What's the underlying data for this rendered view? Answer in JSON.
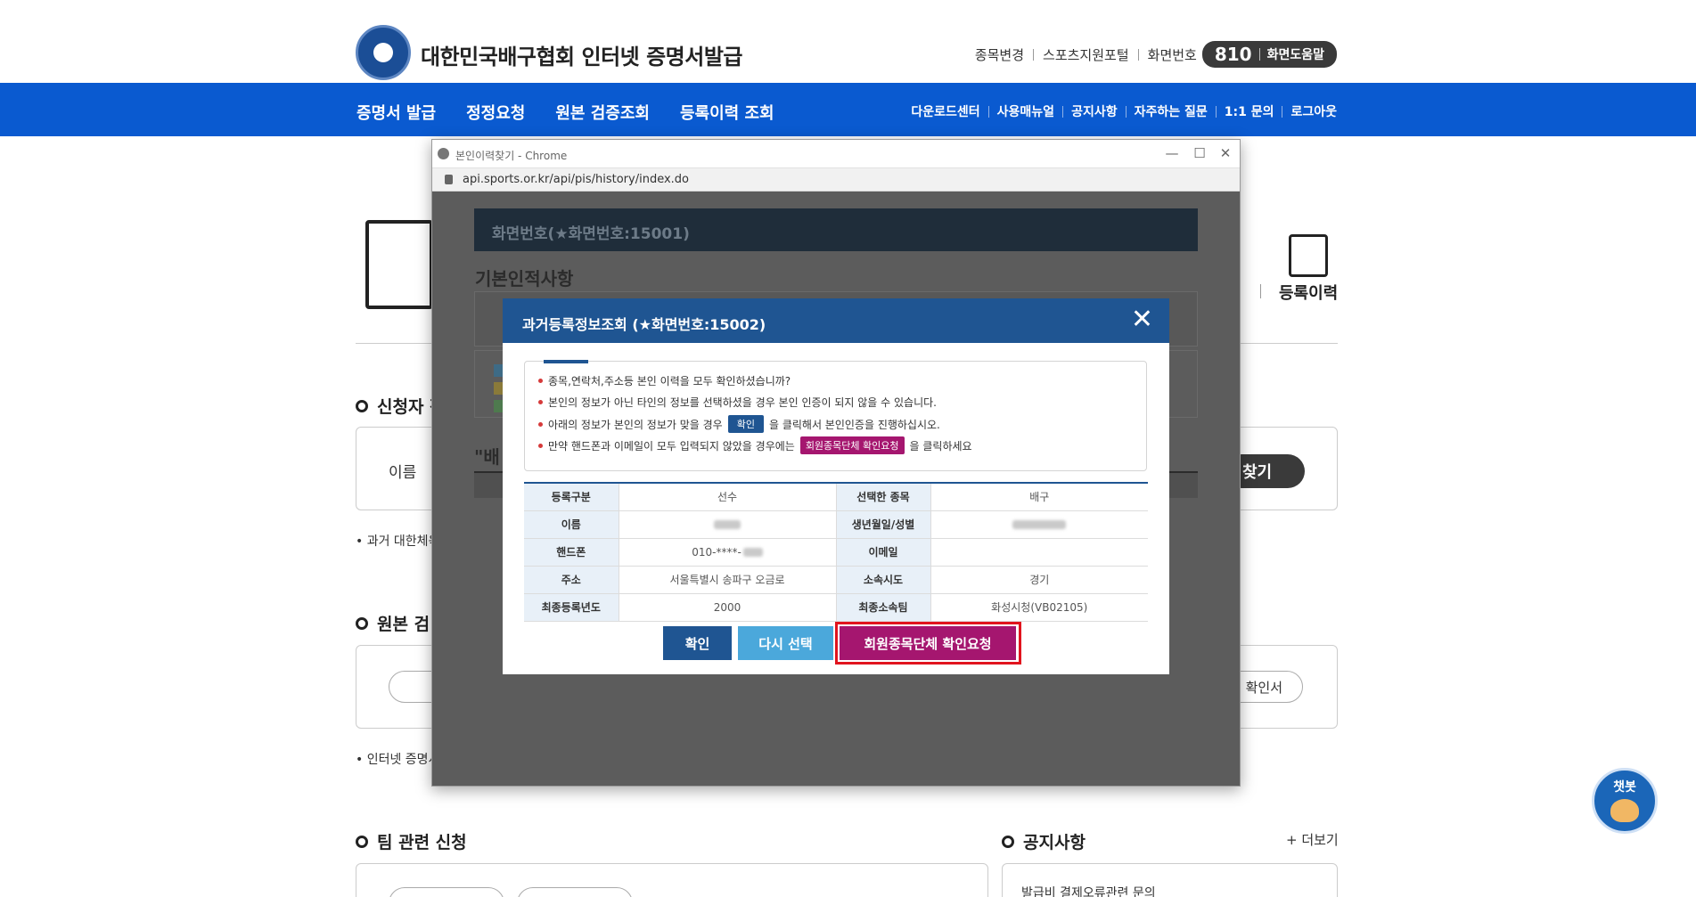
{
  "site": {
    "title": "대한민국배구협회 인터넷 증명서발급",
    "top_links": [
      "종목변경",
      "스포츠지원포털",
      "화면번호"
    ],
    "screen_number": "810",
    "screen_help": "화면도움말"
  },
  "main_menu": [
    "증명서 발급",
    "정정요청",
    "원본 검증조회",
    "등록이력 조회"
  ],
  "util_menu": [
    "다운로드센터",
    "사용매뉴얼",
    "공지사항",
    "자주하는 질문",
    "1:1 문의",
    "로그아웃"
  ],
  "background": {
    "registration_history": "등록이력",
    "applicant_section": "신청자 정",
    "name_label": "이름",
    "find_button": "찾기",
    "past_note": "• 과거 대한체육",
    "original_section": "원본 검",
    "certificate_button": "확인서",
    "internet_note": "• 인터넷 증명서",
    "team_section": "팀 관련 신청",
    "notice_section": "공지사항",
    "more_link": "+ 더보기",
    "notice_item": "발급비 결제오류관련 문의",
    "chatbot": "챗봇"
  },
  "popup": {
    "window_title": "본인이력찾기 - Chrome",
    "url": "api.sports.or.kr/api/pis/history/index.do",
    "inner_header": "화면번호(★화면번호:15001)",
    "inner_heading": "기본인적사항",
    "inner_quote": "\"배"
  },
  "modal": {
    "title": "과거등록정보조회 (★화면번호:15002)",
    "close": "✕",
    "info": {
      "line1": "종목,연락처,주소등 본인 이력을 모두 확인하셨습니까?",
      "line2": "본인의 정보가 아닌 타인의 정보를 선택하셨을 경우 본인 인증이 되지 않을 수 있습니다.",
      "line3_pre": "아래의 정보가 본인의 정보가 맞을 경우",
      "line3_tag": "확인",
      "line3_post": "을 클릭해서 본인인증을 진행하십시오.",
      "line4_pre": "만약 핸드폰과 이메일이 모두 입력되지 않았을 경우에는",
      "line4_tag": "회원종목단체 확인요청",
      "line4_post": "을 클릭하세요"
    },
    "table": {
      "r1": {
        "k1": "등록구분",
        "v1": "선수",
        "k2": "선택한 종목",
        "v2": "배구"
      },
      "r2": {
        "k1": "이름",
        "k2": "생년월일/성별"
      },
      "r3": {
        "k1": "핸드폰",
        "v1": "010-****-",
        "k2": "이메일",
        "v2": ""
      },
      "r4": {
        "k1": "주소",
        "v1": "서울특별시 송파구 오금로",
        "k2": "소속시도",
        "v2": "경기"
      },
      "r5": {
        "k1": "최종등록년도",
        "v1": "2000",
        "k2": "최종소속팀",
        "v2": "화성시청(VB02105)"
      }
    },
    "buttons": {
      "confirm": "확인",
      "reselect": "다시 선택",
      "request": "회원종목단체 확인요청"
    }
  },
  "colors": {
    "nav_blue": "#0a5ad0",
    "modal_blue": "#1f5592",
    "request_magenta": "#a5166f",
    "highlight_red": "#e1141e"
  }
}
